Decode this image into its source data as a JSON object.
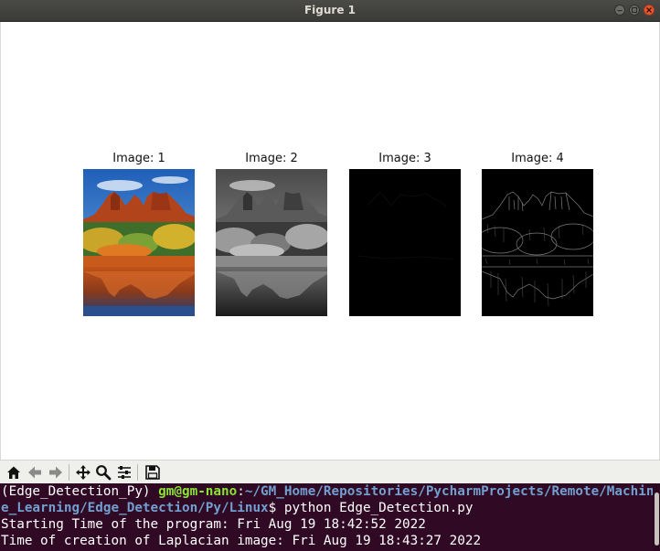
{
  "window": {
    "title": "Figure 1"
  },
  "figure": {
    "subplots": [
      {
        "title": "Image: 1",
        "kind": "color"
      },
      {
        "title": "Image: 2",
        "kind": "grayscale"
      },
      {
        "title": "Image: 3",
        "kind": "laplacian-dark"
      },
      {
        "title": "Image: 4",
        "kind": "edges"
      }
    ]
  },
  "toolbar": {
    "buttons": [
      {
        "name": "home-icon"
      },
      {
        "name": "back-icon"
      },
      {
        "name": "forward-icon"
      },
      {
        "name": "pan-icon"
      },
      {
        "name": "zoom-icon"
      },
      {
        "name": "configure-subplots-icon"
      },
      {
        "name": "save-icon"
      }
    ]
  },
  "terminal": {
    "env": "(Edge_Detection_Py) ",
    "user_host": "gm@gm-nano",
    "colon": ":",
    "path_line1": "~/GM_Home/Repositories/PycharmProjects/Remote/Machin",
    "path_line2": "e_Learning/Edge_Detection/Py/Linux",
    "prompt_char": "$ ",
    "command": "python Edge_Detection.py",
    "output": [
      "Starting Time of the program: Fri Aug 19 18:42:52 2022",
      "Time of creation of Laplacian image: Fri Aug 19 18:43:27 2022"
    ],
    "colors": {
      "background": "#300a24",
      "user": "#8ae234",
      "path": "#729fcf",
      "text": "#ffffff"
    }
  }
}
